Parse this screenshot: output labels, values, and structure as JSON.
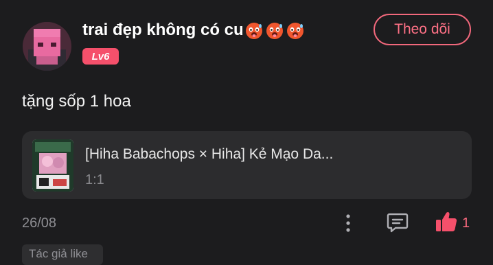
{
  "post": {
    "username": "trai đẹp không có cu",
    "username_emojis": [
      "hot-face-emoji",
      "hot-face-emoji",
      "hot-face-emoji"
    ],
    "level": "Lv6",
    "follow_label": "Theo dõi",
    "text": "tặng sốp 1 hoa",
    "link_card": {
      "title": "[Hiha Babachops × Hiha] Kẻ Mạo Da...",
      "subtitle": "1:1"
    },
    "date": "26/08",
    "like_count": "1",
    "tag": "Tác giả like"
  },
  "colors": {
    "background": "#1c1c1e",
    "accent": "#f5506b",
    "card": "#2c2c2e",
    "muted_text": "#8e8e93"
  },
  "icons": {
    "more": "more-vertical-icon",
    "comment": "comment-icon",
    "like": "thumbs-up-icon"
  }
}
